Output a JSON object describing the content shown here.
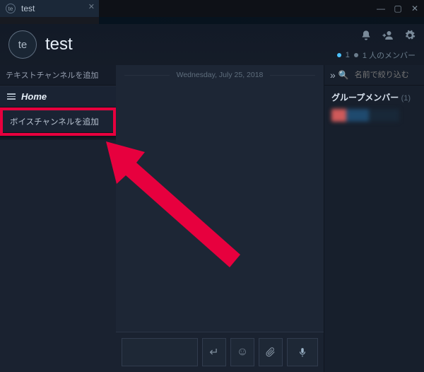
{
  "tab": {
    "label": "test",
    "avatar_text": "te"
  },
  "header": {
    "avatar_text": "te",
    "title": "test",
    "online_count": "1",
    "member_summary": "1 人のメンバー"
  },
  "sidebar": {
    "text_channels_header": "テキストチャンネルを追加",
    "home_label": "Home",
    "voice_channels_header": "ボイスチャンネルを追加"
  },
  "chat": {
    "date_divider": "Wednesday, July 25, 2018"
  },
  "rightbar": {
    "search_placeholder": "名前で絞り込む",
    "group_title": "グループメンバー",
    "group_count": "(1)"
  }
}
